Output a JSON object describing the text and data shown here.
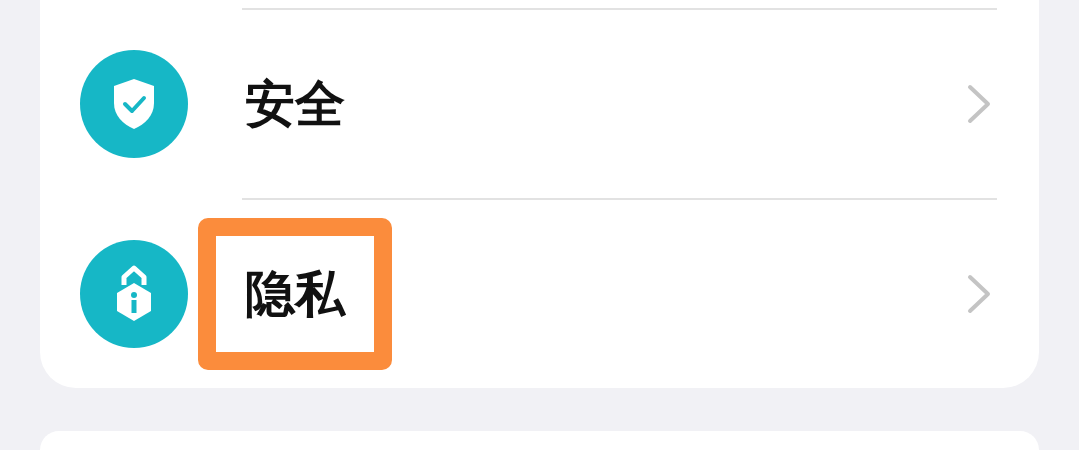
{
  "settings": [
    {
      "kind": "security",
      "label": "安全",
      "highlighted": false
    },
    {
      "kind": "privacy",
      "label": "隐私",
      "highlighted": true
    }
  ]
}
